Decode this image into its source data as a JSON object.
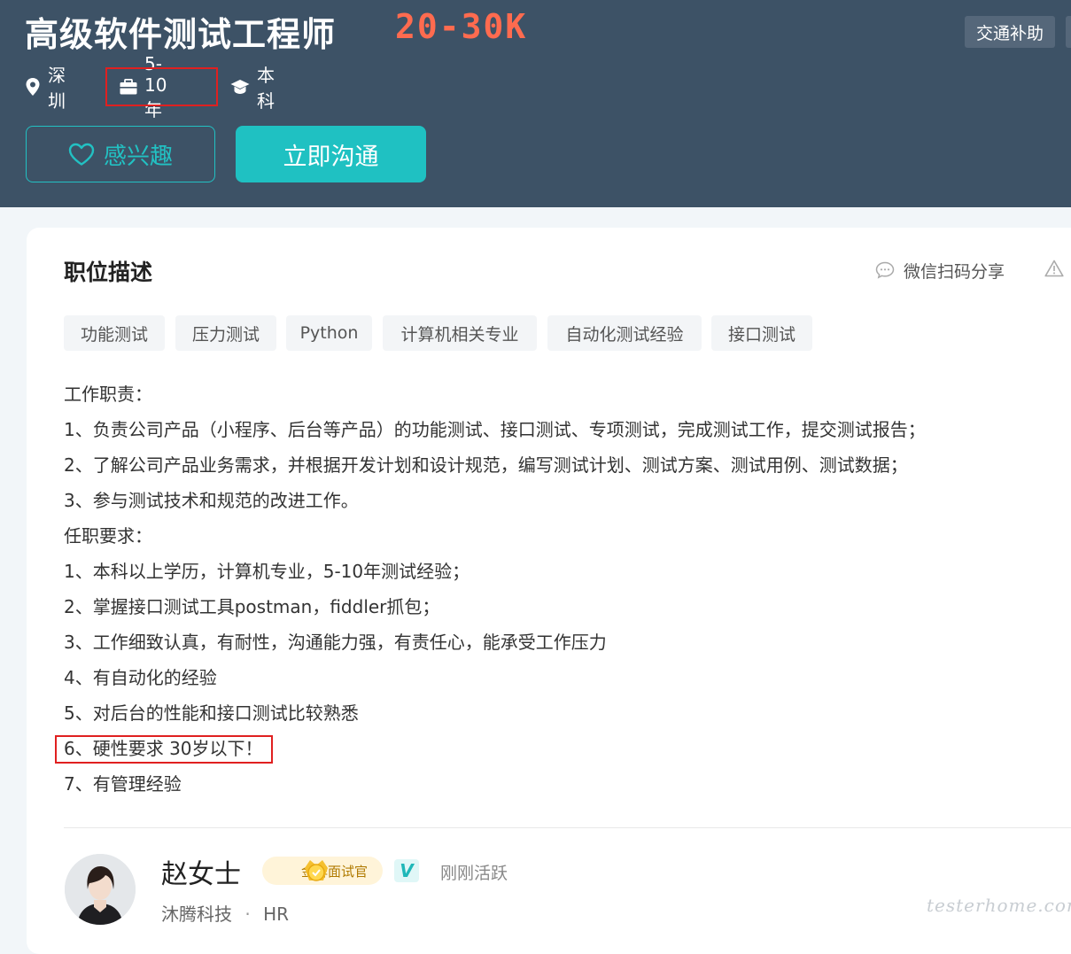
{
  "header": {
    "job_title": "高级软件测试工程师",
    "salary": "20-30K",
    "benefit_tag": "交通补助",
    "meta": {
      "location": "深圳",
      "experience": "5-10年",
      "education": "本科"
    },
    "buttons": {
      "interest": "感兴趣",
      "chat": "立即沟通"
    }
  },
  "section": {
    "title": "职位描述",
    "share": "微信扫码分享"
  },
  "tags": [
    "功能测试",
    "压力测试",
    "Python",
    "计算机相关专业",
    "自动化测试经验",
    "接口测试"
  ],
  "description": [
    "工作职责：",
    "1、负责公司产品（小程序、后台等产品）的功能测试、接口测试、专项测试，完成测试工作，提交测试报告；",
    "2、了解公司产品业务需求，并根据开发计划和设计规范，编写测试计划、测试方案、测试用例、测试数据；",
    "3、参与测试技术和规范的改进工作。",
    "任职要求：",
    "1、本科以上学历，计算机专业，5-10年测试经验；",
    "2、掌握接口测试工具postman，fiddler抓包；",
    "3、工作细致认真，有耐性，沟通能力强，有责任心，能承受工作压力",
    "4、有自动化的经验",
    "5、对后台的性能和接口测试比较熟悉",
    "6、硬性要求 30岁以下！",
    "7、有管理经验"
  ],
  "recruiter": {
    "name": "赵女士",
    "badge": "金牌面试官",
    "verified": "V",
    "status": "刚刚活跃",
    "company": "沐腾科技",
    "separator": "·",
    "role": "HR"
  },
  "watermark": "testerhome.com",
  "colors": {
    "header_bg": "#3d5266",
    "salary": "#ff6b4f",
    "accent": "#1fc1c2",
    "highlight": "#e02020"
  }
}
